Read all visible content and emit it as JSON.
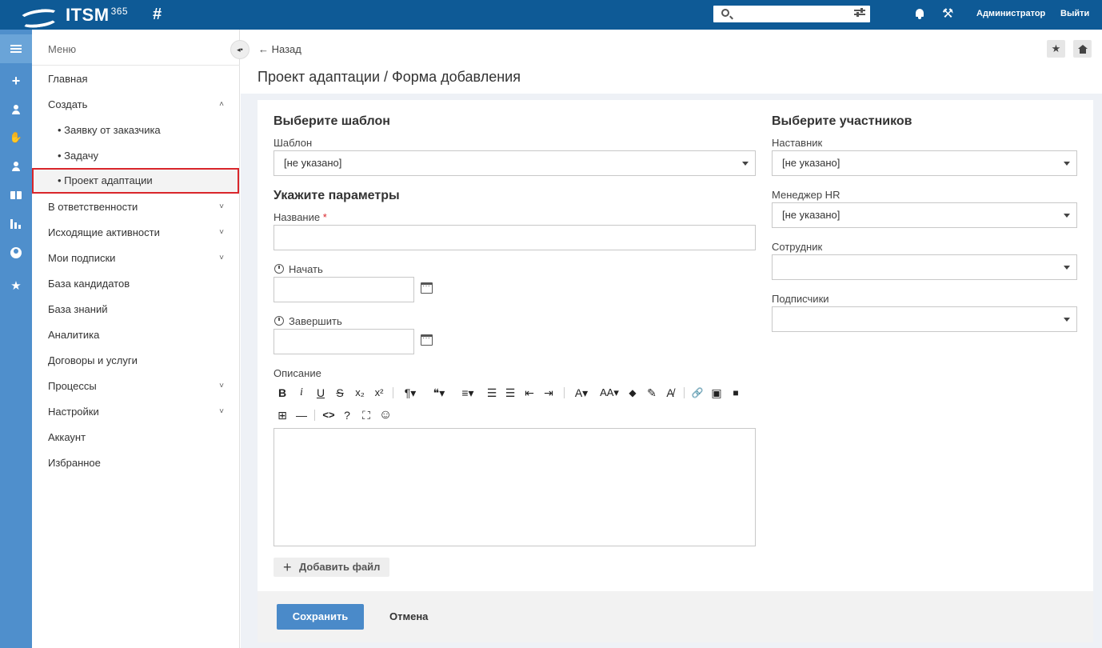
{
  "header": {
    "app_name": "ITSM",
    "app_superscript": "365",
    "hash_symbol": "#",
    "search_placeholder": "",
    "user_name": "Администратор",
    "logout_label": "Выйти"
  },
  "sidebar": {
    "title": "Меню",
    "items": [
      {
        "label": "Главная"
      },
      {
        "label": "Создать",
        "chevron": "˄"
      },
      {
        "label": "• Заявку от заказчика"
      },
      {
        "label": "• Задачу"
      },
      {
        "label": "• Проект адаптации"
      },
      {
        "label": "В ответственности",
        "chevron": "˅"
      },
      {
        "label": "Исходящие активности",
        "chevron": "˅"
      },
      {
        "label": "Мои подписки",
        "chevron": "˅"
      },
      {
        "label": "База кандидатов"
      },
      {
        "label": "База знаний"
      },
      {
        "label": "Аналитика"
      },
      {
        "label": "Договоры и услуги"
      },
      {
        "label": "Процессы",
        "chevron": "˅"
      },
      {
        "label": "Настройки",
        "chevron": "˅"
      },
      {
        "label": "Аккаунт"
      },
      {
        "label": "Избранное"
      }
    ]
  },
  "rail_icons": [
    "hamburger-icon",
    "plus-icon",
    "user-plus-icon",
    "handshake-icon",
    "user-add-icon",
    "book-icon",
    "bar-chart-icon",
    "user-circle-icon",
    "star-icon"
  ],
  "page": {
    "back_label": "← Назад",
    "title": "Проект адаптации / Форма добавления"
  },
  "form": {
    "template_section": "Выберите шаблон",
    "template_label": "Шаблон",
    "template_value": "[не указано]",
    "params_section": "Укажите параметры",
    "name_label": "Название",
    "required_mark": "*",
    "start_label": "Начать",
    "end_label": "Завершить",
    "description_label": "Описание",
    "add_file_label": "Добавить файл",
    "participants_section": "Выберите участников",
    "mentor_label": "Наставник",
    "mentor_value": "[не указано]",
    "hr_label": "Менеджер HR",
    "hr_value": "[не указано]",
    "employee_label": "Сотрудник",
    "employee_value": "",
    "subscribers_label": "Подписчики",
    "subscribers_value": ""
  },
  "editor_toolbar": {
    "bold": "B",
    "italic": "i",
    "underline": "U",
    "strike": "S",
    "subscript": "x₂",
    "superscript": "x²",
    "paragraph": "¶▾",
    "quote": "❝▾",
    "align": "≡▾",
    "ol": "☰",
    "ul": "☰",
    "outdent": "⇤",
    "indent": "⇥",
    "font_color": "A▾",
    "font_size": "AA▾",
    "fill": "◆",
    "marker": "✎",
    "clear": "A̸",
    "link": "🔗",
    "image": "▣",
    "video": "■",
    "table": "⊞",
    "hr": "—",
    "code": "<>",
    "help": "?",
    "fullscreen": "⛶",
    "emoji": "☺"
  },
  "actions": {
    "save_label": "Сохранить",
    "cancel_label": "Отмена"
  },
  "colors": {
    "topbar": "#0e5a96",
    "rail": "#4f8fcc",
    "primary_button": "#4a8ac9",
    "highlight_border": "#d9262b"
  }
}
